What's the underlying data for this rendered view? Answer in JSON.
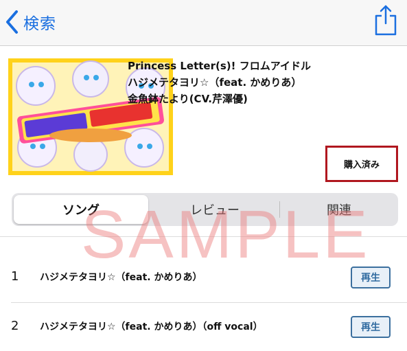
{
  "nav": {
    "back_label": "検索"
  },
  "track": {
    "title_line1": "Princess Letter(s)! フロムアイドル",
    "title_line2": "ハジメテタヨリ☆（feat. かめりあ）",
    "artist": "金魚鉢たより(CV.芹澤優)"
  },
  "purchased_label": "購入済み",
  "tabs": [
    {
      "label": "ソング",
      "active": true
    },
    {
      "label": "レビュー",
      "active": false
    },
    {
      "label": "関連",
      "active": false
    }
  ],
  "songs": [
    {
      "num": "1",
      "name": "ハジメテタヨリ☆（feat. かめりあ）",
      "play_label": "再生"
    },
    {
      "num": "2",
      "name": "ハジメテタヨリ☆（feat. かめりあ）（off vocal）",
      "play_label": "再生"
    }
  ],
  "watermark": "SAMPLE",
  "colors": {
    "accent": "#1a6fe0",
    "purchased_border": "#b0171f",
    "play_border": "#3b6f9e",
    "album_bg": "#ffd21a",
    "watermark": "#eb7878"
  },
  "icons": {
    "back": "chevron-left-icon",
    "share": "share-icon"
  }
}
